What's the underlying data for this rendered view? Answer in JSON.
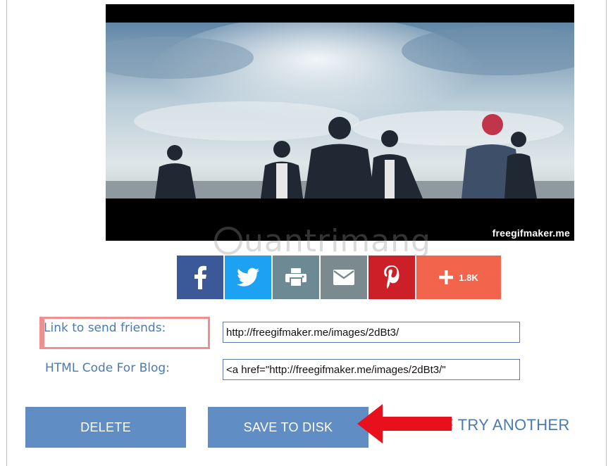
{
  "preview": {
    "watermark": "freegifmaker.me"
  },
  "site_watermark": {
    "text": "uantrimang"
  },
  "share": {
    "facebook_icon": "facebook-icon",
    "twitter_icon": "twitter-icon",
    "print_icon": "printer-icon",
    "email_icon": "envelope-icon",
    "pinterest_icon": "pinterest-icon",
    "more_icon": "plus-icon",
    "more_count": "1.8K",
    "colors": {
      "facebook": "#3b5998",
      "twitter": "#1da1f2",
      "print": "#6d8a94",
      "email": "#7b8a8f",
      "pinterest": "#cb2027",
      "more": "#f2644c"
    }
  },
  "links": {
    "friends_label": "Link to send friends:",
    "friends_value": "http://freegifmaker.me/images/2dBt3/",
    "blog_label": "HTML Code For Blog:",
    "blog_value": "<a href=\"http://freegifmaker.me/images/2dBt3/\""
  },
  "actions": {
    "delete_label": "DELETE",
    "save_label": "SAVE TO DISK",
    "try_another_label": "GIF TRY ANOTHER",
    "button_color": "#5f8dc4",
    "arrow_color": "#e8101c"
  }
}
